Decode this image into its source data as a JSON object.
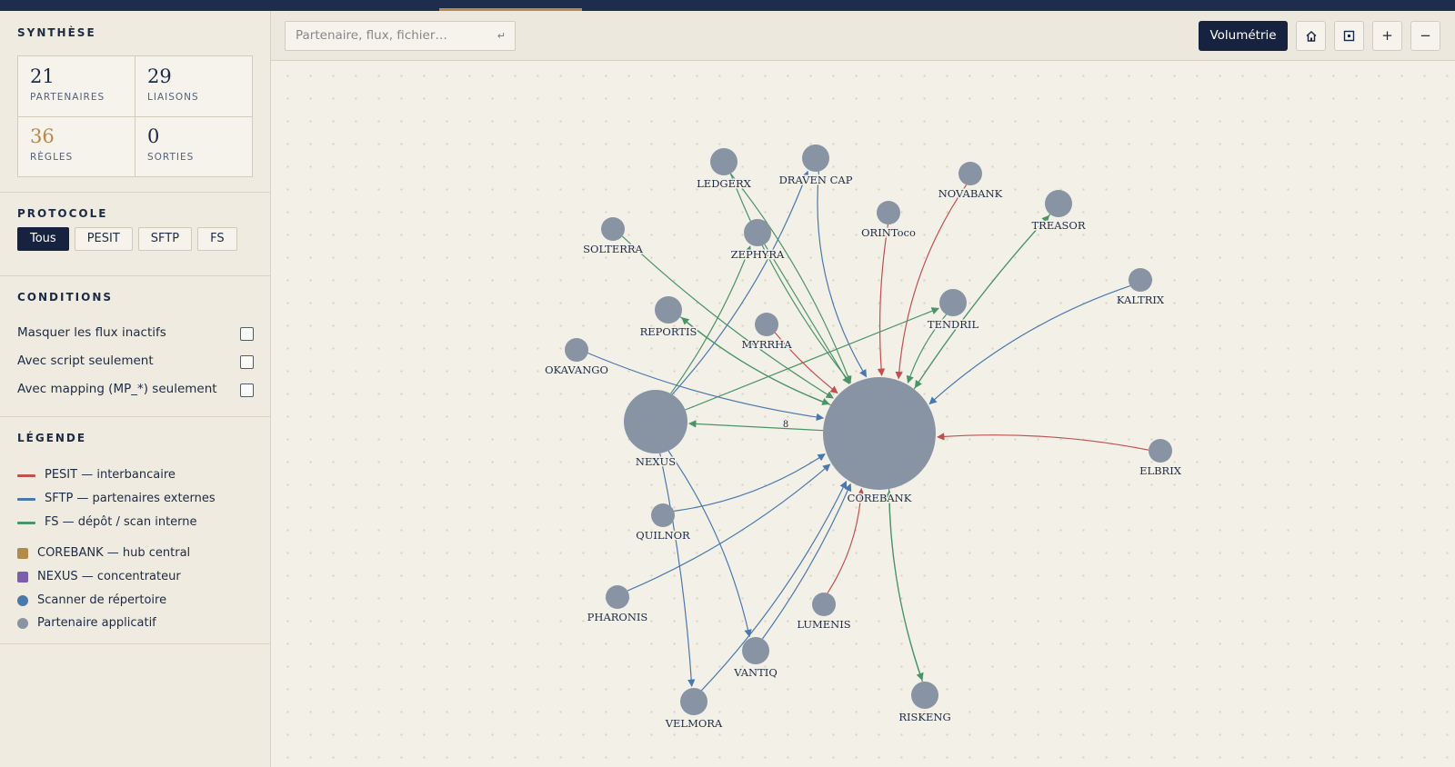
{
  "toolbar": {
    "search_placeholder": "Partenaire, flux, fichier…",
    "enter_hint": "↵",
    "volumetrie_label": "Volumétrie",
    "home_icon": "home-icon",
    "fit_icon": "fit-icon",
    "zoom_in_label": "+",
    "zoom_out_label": "−"
  },
  "synthese": {
    "title": "SYNTHÈSE",
    "stats": [
      {
        "value": "21",
        "label": "PARTENAIRES"
      },
      {
        "value": "29",
        "label": "LIAISONS"
      },
      {
        "value": "36",
        "label": "RÈGLES"
      },
      {
        "value": "0",
        "label": "SORTIES"
      }
    ]
  },
  "protocole": {
    "title": "PROTOCOLE",
    "options": [
      "Tous",
      "PESIT",
      "SFTP",
      "FS"
    ],
    "selected": "Tous"
  },
  "conditions": {
    "title": "CONDITIONS",
    "items": [
      {
        "label": "Masquer les flux inactifs",
        "checked": false
      },
      {
        "label": "Avec script seulement",
        "checked": false
      },
      {
        "label": "Avec mapping (MP_*) seulement",
        "checked": false
      }
    ]
  },
  "legende": {
    "title": "LÉGENDE",
    "lines": [
      {
        "label": "PESIT — interbancaire",
        "color": "#c0504d"
      },
      {
        "label": "SFTP — partenaires externes",
        "color": "#4a78ad"
      },
      {
        "label": "FS — dépôt / scan interne",
        "color": "#4a9466"
      }
    ],
    "markers": [
      {
        "label": "COREBANK — hub central",
        "color": "#b18b4a",
        "shape": "square"
      },
      {
        "label": "NEXUS — concentrateur",
        "color": "#7b5fae",
        "shape": "square"
      },
      {
        "label": "Scanner de répertoire",
        "color": "#4a78ad",
        "shape": "circle"
      },
      {
        "label": "Partenaire applicatif",
        "color": "#8893a3",
        "shape": "circle"
      }
    ]
  },
  "graph": {
    "node_color": "#8893a3",
    "colors": {
      "PESIT": "#c0504d",
      "SFTP": "#4a78ad",
      "FS": "#4a9466"
    },
    "nodes": [
      {
        "id": "COREBANK",
        "label": "COREBANK"
      },
      {
        "id": "NEXUS",
        "label": "NEXUS"
      },
      {
        "id": "LEDGERX",
        "label": "LEDGERX"
      },
      {
        "id": "DRAVEN",
        "label": "DRAVEN CAP"
      },
      {
        "id": "NOVABANK",
        "label": "NOVABANK"
      },
      {
        "id": "TREASOR",
        "label": "TREASOR"
      },
      {
        "id": "ORINTOCO",
        "label": "ORINToco"
      },
      {
        "id": "SOLTERRA",
        "label": "SOLTERRA"
      },
      {
        "id": "ZEPHYRA",
        "label": "ZEPHYRA"
      },
      {
        "id": "KALTRIX",
        "label": "KALTRIX"
      },
      {
        "id": "TENDRIL",
        "label": "TENDRIL"
      },
      {
        "id": "REPORTIS",
        "label": "REPORTIS"
      },
      {
        "id": "MYRRHA",
        "label": "MYRRHA"
      },
      {
        "id": "OKAVANGO",
        "label": "OKAVANGO"
      },
      {
        "id": "ELBRIX",
        "label": "ELBRIX"
      },
      {
        "id": "QUILNOR",
        "label": "QUILNOR"
      },
      {
        "id": "PHARONIS",
        "label": "PHARONIS"
      },
      {
        "id": "LUMENIS",
        "label": "LUMENIS"
      },
      {
        "id": "VANTIQ",
        "label": "VANTIQ"
      },
      {
        "id": "VELMORA",
        "label": "VELMORA"
      },
      {
        "id": "RISKENG",
        "label": "RISKENG"
      }
    ],
    "edges": [
      {
        "from": "LEDGERX",
        "to": "COREBANK",
        "proto": "FS"
      },
      {
        "from": "LEDGERX",
        "to": "COREBANK",
        "proto": "FS"
      },
      {
        "from": "DRAVEN",
        "to": "COREBANK",
        "proto": "SFTP"
      },
      {
        "from": "NOVABANK",
        "to": "COREBANK",
        "proto": "PESIT"
      },
      {
        "from": "ORINTOCO",
        "to": "COREBANK",
        "proto": "PESIT"
      },
      {
        "from": "TREASOR",
        "to": "COREBANK",
        "proto": "FS"
      },
      {
        "from": "COREBANK",
        "to": "TREASOR",
        "proto": "FS"
      },
      {
        "from": "KALTRIX",
        "to": "COREBANK",
        "proto": "SFTP"
      },
      {
        "from": "TENDRIL",
        "to": "COREBANK",
        "proto": "FS"
      },
      {
        "from": "NEXUS",
        "to": "TENDRIL",
        "proto": "FS"
      },
      {
        "from": "SOLTERRA",
        "to": "COREBANK",
        "proto": "FS"
      },
      {
        "from": "ZEPHYRA",
        "to": "COREBANK",
        "proto": "FS"
      },
      {
        "from": "NEXUS",
        "to": "ZEPHYRA",
        "proto": "FS"
      },
      {
        "from": "NEXUS",
        "to": "DRAVEN",
        "proto": "SFTP"
      },
      {
        "from": "REPORTIS",
        "to": "COREBANK",
        "proto": "FS"
      },
      {
        "from": "COREBANK",
        "to": "REPORTIS",
        "proto": "FS"
      },
      {
        "from": "MYRRHA",
        "to": "COREBANK",
        "proto": "PESIT"
      },
      {
        "from": "OKAVANGO",
        "to": "COREBANK",
        "proto": "SFTP"
      },
      {
        "from": "COREBANK",
        "to": "NEXUS",
        "proto": "FS"
      },
      {
        "from": "ELBRIX",
        "to": "COREBANK",
        "proto": "PESIT"
      },
      {
        "from": "QUILNOR",
        "to": "COREBANK",
        "proto": "SFTP"
      },
      {
        "from": "PHARONIS",
        "to": "COREBANK",
        "proto": "SFTP"
      },
      {
        "from": "LUMENIS",
        "to": "COREBANK",
        "proto": "PESIT"
      },
      {
        "from": "VANTIQ",
        "to": "COREBANK",
        "proto": "SFTP"
      },
      {
        "from": "VELMORA",
        "to": "COREBANK",
        "proto": "SFTP"
      },
      {
        "from": "NEXUS",
        "to": "VANTIQ",
        "proto": "SFTP"
      },
      {
        "from": "NEXUS",
        "to": "VELMORA",
        "proto": "SFTP"
      },
      {
        "from": "COREBANK",
        "to": "RISKENG",
        "proto": "FS"
      },
      {
        "from": "RISKENG",
        "to": "COREBANK",
        "proto": "FS"
      }
    ],
    "edge_label": "8"
  }
}
